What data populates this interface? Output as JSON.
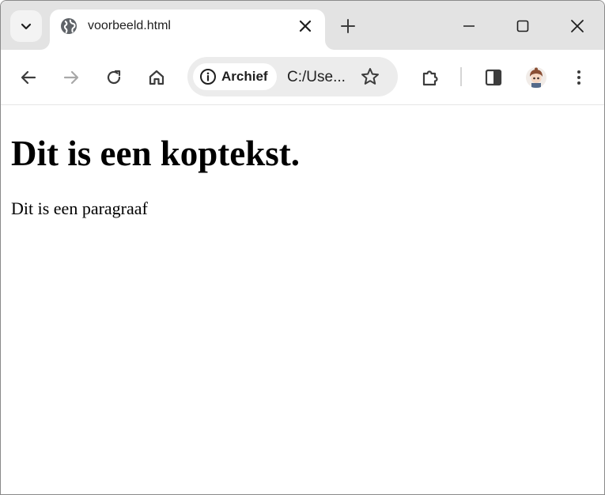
{
  "tab": {
    "title": "voorbeeld.html"
  },
  "addressbar": {
    "chip_label": "Archief",
    "url": "C:/Use..."
  },
  "page": {
    "heading": "Dit is een koptekst.",
    "paragraph": "Dit is een paragraaf"
  },
  "colors": {
    "tabstrip": "#e3e3e3",
    "omnibox": "#ececec",
    "icon": "#3c3c3c",
    "disabled_icon": "#a8a8a8"
  },
  "icons": {
    "tab_search": "chevron-down-icon",
    "favicon": "globe-icon",
    "tab_close": "close-icon",
    "new_tab": "plus-icon",
    "back": "arrow-left-icon",
    "forward": "arrow-right-icon",
    "reload": "reload-icon",
    "home": "home-icon",
    "site_info": "info-icon",
    "bookmark": "star-icon",
    "extensions": "puzzle-icon",
    "side_panel": "side-panel-icon",
    "profile": "avatar",
    "menu": "kebab-menu-icon"
  }
}
